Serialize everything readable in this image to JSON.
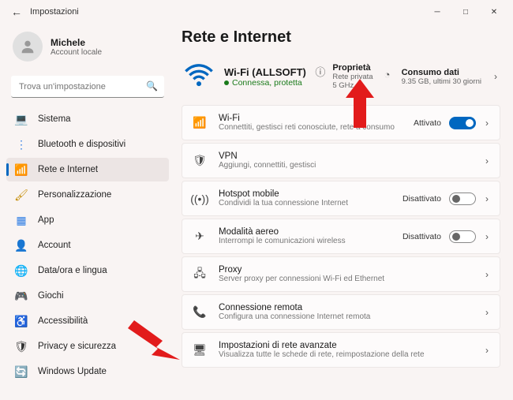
{
  "window": {
    "title": "Impostazioni"
  },
  "user": {
    "name": "Michele",
    "sub": "Account locale"
  },
  "search": {
    "placeholder": "Trova un'impostazione"
  },
  "nav": [
    {
      "label": "Sistema",
      "iconColor": "#2e7de4",
      "glyph": "💻"
    },
    {
      "label": "Bluetooth e dispositivi",
      "iconColor": "#2e7de4",
      "glyph": "⋮"
    },
    {
      "label": "Rete e Internet",
      "iconColor": "#2e7de4",
      "glyph": "📶",
      "active": true
    },
    {
      "label": "Personalizzazione",
      "iconColor": "#c48a00",
      "glyph": "🖌"
    },
    {
      "label": "App",
      "iconColor": "#2e7de4",
      "glyph": "▦"
    },
    {
      "label": "Account",
      "iconColor": "#2aa162",
      "glyph": "👤"
    },
    {
      "label": "Data/ora e lingua",
      "iconColor": "#333",
      "glyph": "🌐"
    },
    {
      "label": "Giochi",
      "iconColor": "#333",
      "glyph": "🎮"
    },
    {
      "label": "Accessibilità",
      "iconColor": "#2e7de4",
      "glyph": "♿"
    },
    {
      "label": "Privacy e sicurezza",
      "iconColor": "#333",
      "glyph": "🛡"
    },
    {
      "label": "Windows Update",
      "iconColor": "#2e7de4",
      "glyph": "🔄"
    }
  ],
  "page": {
    "heading": "Rete e Internet",
    "hero": {
      "ssid": "Wi-Fi (ALLSOFT)",
      "status": "Connessa, protetta",
      "prop_title": "Proprietà",
      "prop_sub1": "Rete privata",
      "prop_sub2": "5 GHz",
      "data_title": "Consumo dati",
      "data_sub": "9.35 GB, ultimi 30 giorni"
    },
    "cards": [
      {
        "icon": "wifi",
        "title": "Wi-Fi",
        "sub": "Connettiti, gestisci reti conosciute, rete a consumo",
        "state": "Attivato",
        "toggle": "on"
      },
      {
        "icon": "vpn",
        "title": "VPN",
        "sub": "Aggiungi, connettiti, gestisci"
      },
      {
        "icon": "hotspot",
        "title": "Hotspot mobile",
        "sub": "Condividi la tua connessione Internet",
        "state": "Disattivato",
        "toggle": "off"
      },
      {
        "icon": "airplane",
        "title": "Modalità aereo",
        "sub": "Interrompi le comunicazioni wireless",
        "state": "Disattivato",
        "toggle": "off"
      },
      {
        "icon": "proxy",
        "title": "Proxy",
        "sub": "Server proxy per connessioni Wi-Fi ed Ethernet"
      },
      {
        "icon": "dialup",
        "title": "Connessione remota",
        "sub": "Configura una connessione Internet remota"
      },
      {
        "icon": "adv",
        "title": "Impostazioni di rete avanzate",
        "sub": "Visualizza tutte le schede di rete, reimpostazione della rete"
      }
    ]
  }
}
